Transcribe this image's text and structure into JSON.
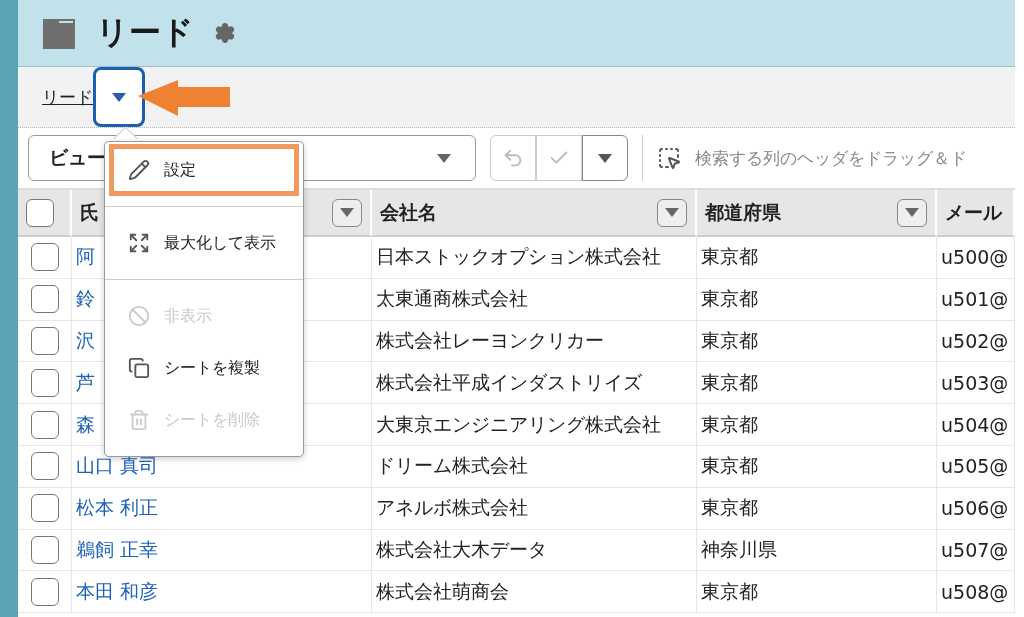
{
  "header": {
    "title": "リード"
  },
  "tab": {
    "label": "リード",
    "focused": true
  },
  "toolbar": {
    "view_select": "ビュー",
    "search_hint": "検索する列のヘッダをドラッグ＆ド"
  },
  "table": {
    "header_checkbox": {
      "checked": false
    },
    "columns": [
      "氏",
      "会社名",
      "都道府県",
      "メール"
    ],
    "rows": [
      {
        "checked": false,
        "name": "阿",
        "company": "日本ストックオプション株式会社",
        "prefecture": "東京都",
        "email": "u500@"
      },
      {
        "checked": false,
        "name": "鈴",
        "company": "太東通商株式会社",
        "prefecture": "東京都",
        "email": "u501@"
      },
      {
        "checked": false,
        "name": "沢",
        "company": "株式会社レーヨンクリカー",
        "prefecture": "東京都",
        "email": "u502@"
      },
      {
        "checked": false,
        "name": "芦",
        "company": "株式会社平成インダストリイズ",
        "prefecture": "東京都",
        "email": "u503@"
      },
      {
        "checked": false,
        "name": "森",
        "company": "大東京エンジニアリング株式会社",
        "prefecture": "東京都",
        "email": "u504@"
      },
      {
        "checked": false,
        "name": "山口 真司",
        "company": "ドリーム株式会社",
        "prefecture": "東京都",
        "email": "u505@"
      },
      {
        "checked": false,
        "name": "松本 利正",
        "company": "アネルボ株式会社",
        "prefecture": "東京都",
        "email": "u506@"
      },
      {
        "checked": false,
        "name": "鵜飼 正幸",
        "company": "株式会社大木データ",
        "prefecture": "神奈川県",
        "email": "u507@"
      },
      {
        "checked": false,
        "name": "本田 和彦",
        "company": "株式会社萌商会",
        "prefecture": "東京都",
        "email": "u508@"
      }
    ]
  },
  "menu": {
    "items": [
      {
        "kind": "edit",
        "label": "設定",
        "disabled": false,
        "highlighted": true
      },
      {
        "kind": "divider"
      },
      {
        "kind": "maximize",
        "label": "最大化して表示",
        "disabled": false,
        "highlighted": false
      },
      {
        "kind": "divider"
      },
      {
        "kind": "hide",
        "label": "非表示",
        "disabled": true,
        "highlighted": false
      },
      {
        "kind": "duplicate",
        "label": "シートを複製",
        "disabled": false,
        "highlighted": false
      },
      {
        "kind": "delete",
        "label": "シートを削除",
        "disabled": true,
        "highlighted": false
      }
    ]
  }
}
